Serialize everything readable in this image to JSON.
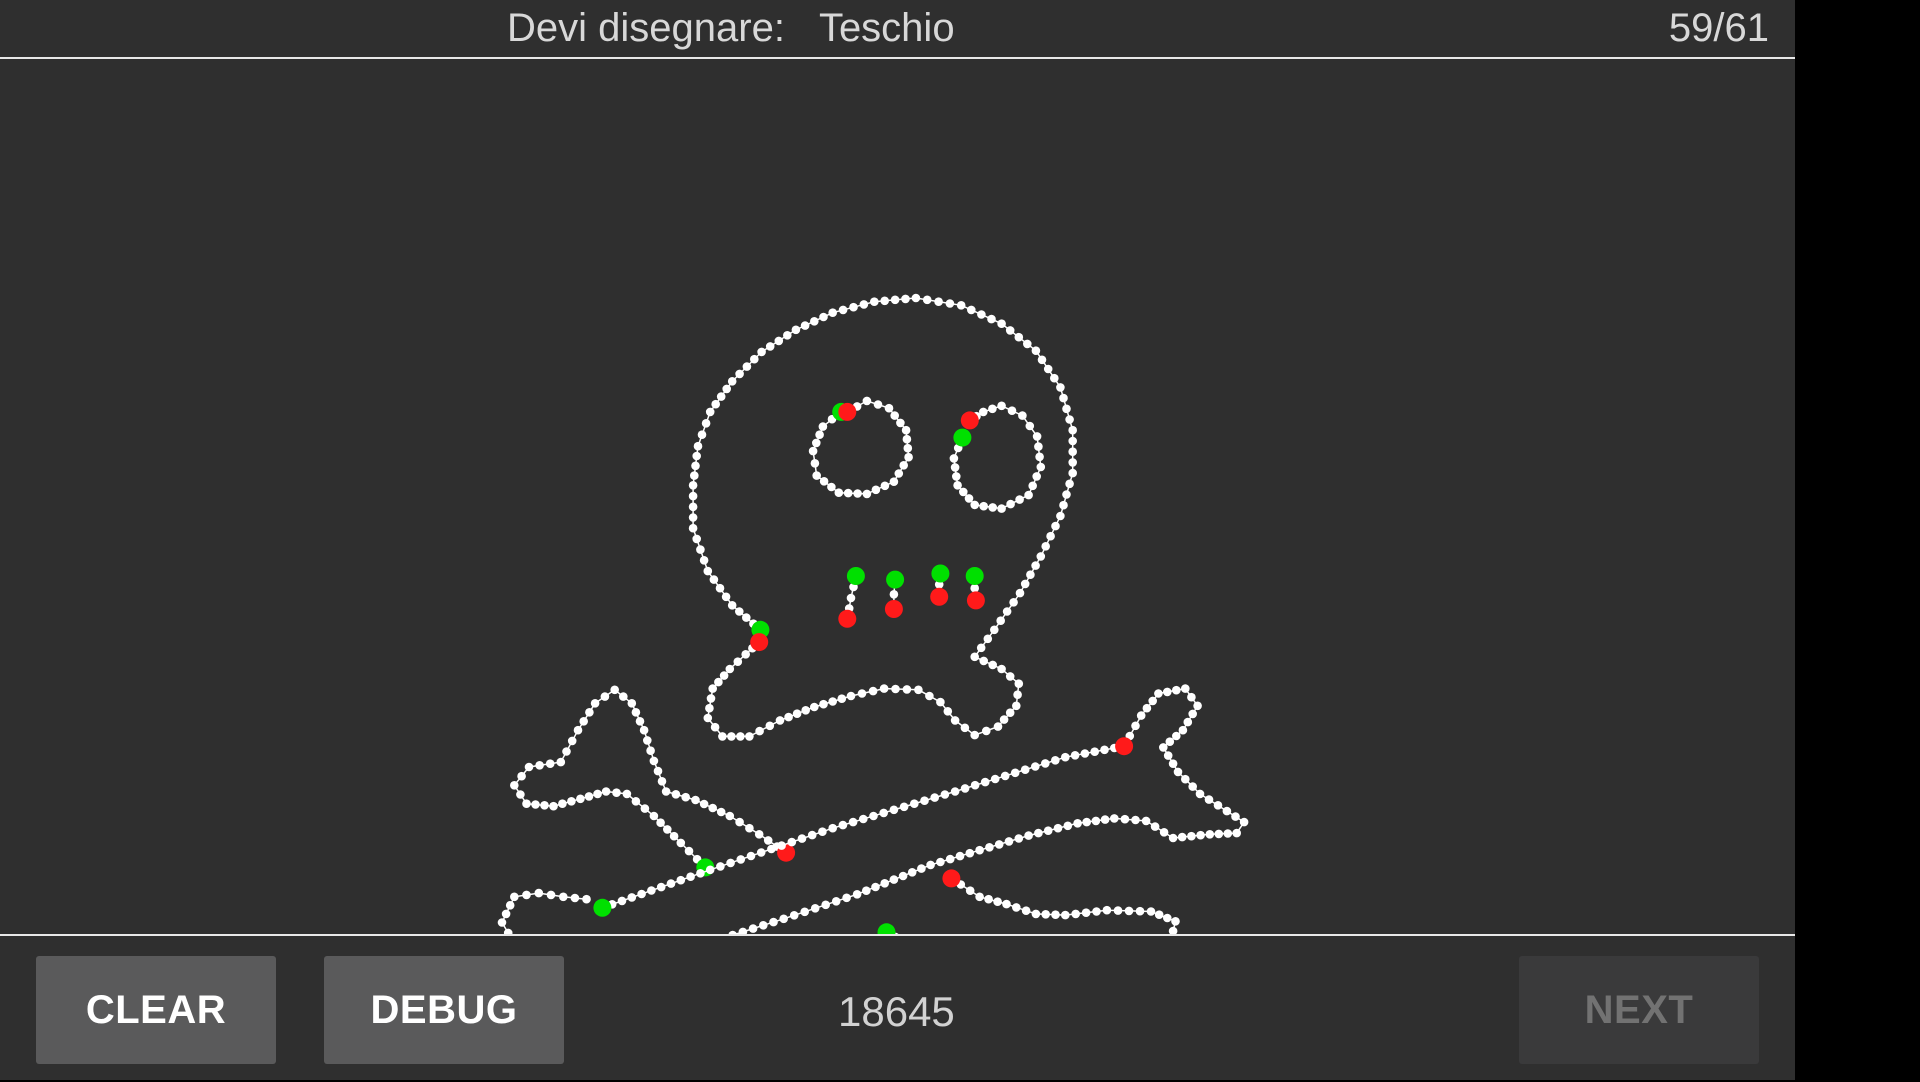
{
  "header": {
    "prompt_label": "Devi disegnare:",
    "target_word": "Teschio",
    "progress": "59/61"
  },
  "canvas": {
    "drawing": "skull and crossbones",
    "stroke_color": "#ffffff",
    "stroke_start_color": "#00e000",
    "stroke_end_color": "#ff1a1a"
  },
  "footer": {
    "clear_label": "CLEAR",
    "debug_label": "DEBUG",
    "score": "18645",
    "next_label": "NEXT"
  },
  "colors": {
    "background": "#2f2f2f",
    "button": "#5a5a5b",
    "button_disabled": "#3a3a3b"
  }
}
